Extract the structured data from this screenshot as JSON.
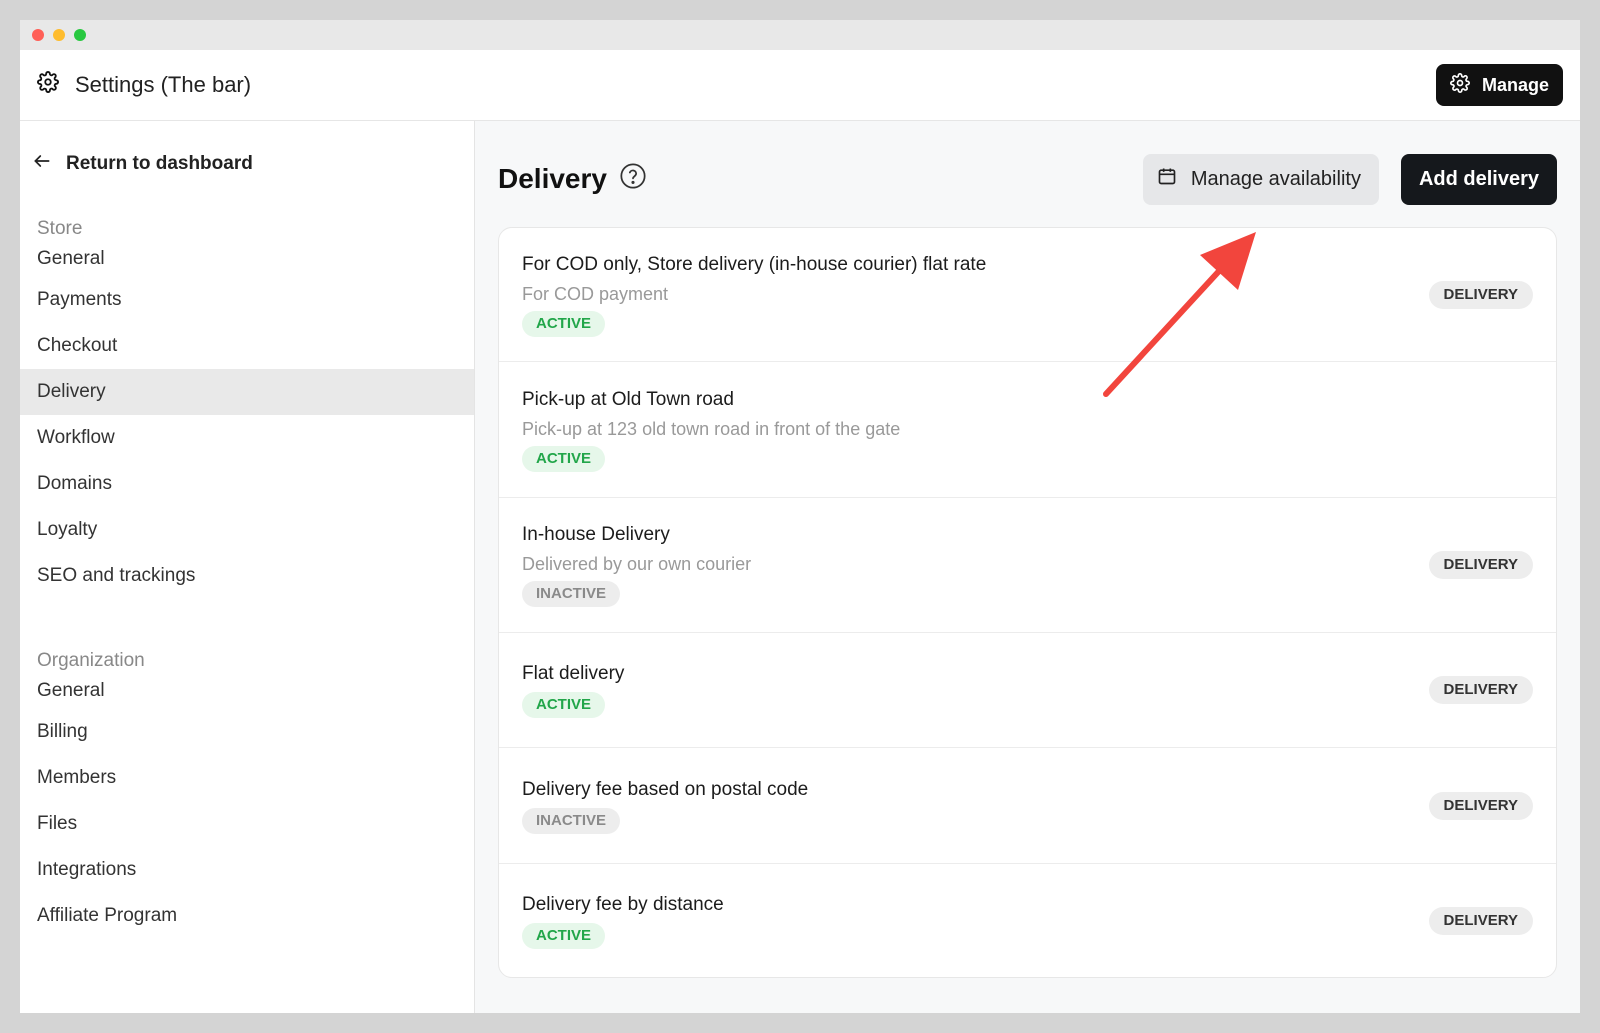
{
  "header": {
    "title": "Settings (The bar)",
    "manage_label": "Manage"
  },
  "sidebar": {
    "back_label": "Return to dashboard",
    "store_label": "Store",
    "store_items": [
      {
        "label": "General"
      },
      {
        "label": "Payments"
      },
      {
        "label": "Checkout"
      },
      {
        "label": "Delivery",
        "active": true
      },
      {
        "label": "Workflow"
      },
      {
        "label": "Domains"
      },
      {
        "label": "Loyalty"
      },
      {
        "label": "SEO and trackings"
      }
    ],
    "org_label": "Organization",
    "org_items": [
      {
        "label": "General"
      },
      {
        "label": "Billing"
      },
      {
        "label": "Members"
      },
      {
        "label": "Files"
      },
      {
        "label": "Integrations"
      },
      {
        "label": "Affiliate Program"
      }
    ]
  },
  "main": {
    "title": "Delivery",
    "manage_availability_label": "Manage availability",
    "add_delivery_label": "Add delivery",
    "rows": [
      {
        "name": "For COD only, Store delivery (in-house courier) flat rate",
        "desc": "For COD payment",
        "status": "ACTIVE",
        "type": "DELIVERY"
      },
      {
        "name": "Pick-up at Old Town road",
        "desc": "Pick-up at 123 old town road in front of the gate",
        "status": "ACTIVE",
        "type": ""
      },
      {
        "name": "In-house Delivery",
        "desc": "Delivered by our own courier",
        "status": "INACTIVE",
        "type": "DELIVERY"
      },
      {
        "name": "Flat delivery",
        "desc": "",
        "status": "ACTIVE",
        "type": "DELIVERY"
      },
      {
        "name": "Delivery fee based on postal code",
        "desc": "",
        "status": "INACTIVE",
        "type": "DELIVERY"
      },
      {
        "name": "Delivery fee by distance",
        "desc": "",
        "status": "ACTIVE",
        "type": "DELIVERY"
      }
    ]
  },
  "colors": {
    "active_text": "#22a64a",
    "active_bg": "#e6f7ea",
    "inactive_text": "#8a8a8a",
    "primary_button": "#15181c",
    "annotation_arrow": "#f2453d"
  },
  "icons": {
    "app": "gear-icon",
    "back": "arrow-left-icon",
    "help": "question-circle-icon",
    "availability": "calendar-icon"
  }
}
